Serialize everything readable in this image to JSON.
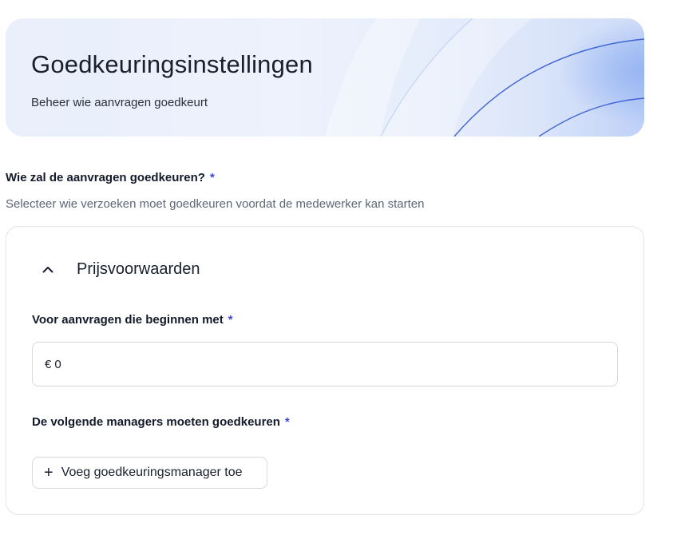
{
  "header": {
    "title": "Goedkeuringsinstellingen",
    "subtitle": "Beheer wie aanvragen goedkeurt"
  },
  "question": {
    "label": "Wie zal de aanvragen goedkeuren?",
    "required_mark": "*",
    "help": "Selecteer wie verzoeken moet goedkeuren voordat de medewerker kan starten"
  },
  "section": {
    "title": "Prijsvoorwaarden",
    "expanded": true,
    "icon": "chevron-up-icon"
  },
  "amount_field": {
    "label": "Voor aanvragen die beginnen met",
    "required_mark": "*",
    "currency": "€",
    "value": "0"
  },
  "managers_field": {
    "label": "De volgende managers moeten goedkeuren",
    "required_mark": "*",
    "add_button_icon": "plus-icon",
    "add_button_label": "Voeg goedkeuringsmanager toe"
  },
  "colors": {
    "accent_required": "#3b47d8",
    "hero_gradient_start": "#e9effb",
    "hero_gradient_end": "#cfdcf8",
    "wave_line": "#3f63d6"
  }
}
